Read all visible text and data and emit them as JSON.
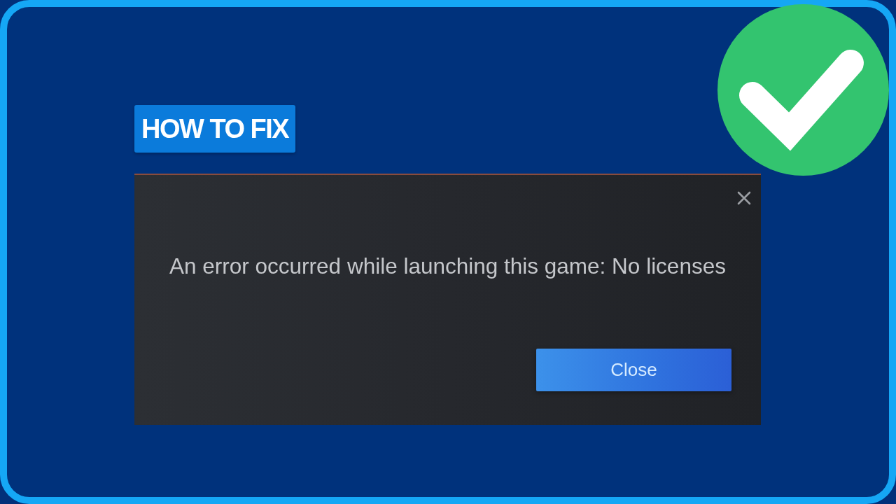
{
  "badge": {
    "text": "HOW TO FIX"
  },
  "dialog": {
    "message": "An error occurred while launching this game: No licenses",
    "buttons": [
      {
        "label": "Close",
        "kind": "primary"
      }
    ]
  }
}
